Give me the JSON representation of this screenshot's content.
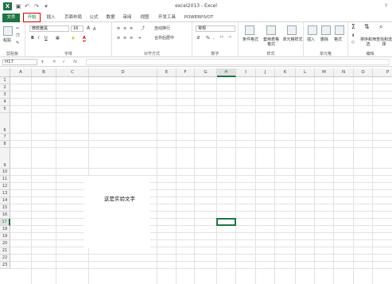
{
  "window": {
    "title": "excel2013 - Excel",
    "logo": "X",
    "help": "?",
    "qat_icons": [
      "save-icon",
      "undo-icon",
      "redo-icon",
      "customize-icon"
    ]
  },
  "tabs": [
    "文件",
    "开始",
    "插入",
    "页面布局",
    "公式",
    "数据",
    "审阅",
    "视图",
    "开发工具",
    "POWERPIVOT"
  ],
  "ribbon": {
    "clipboard": {
      "paste": "粘贴",
      "label": "剪贴板"
    },
    "font": {
      "name": "微软雅黑",
      "size": "16",
      "grow": "A",
      "shrink": "A",
      "bold": "B",
      "italic": "I",
      "underline": "U",
      "font_color": "A",
      "label": "字体"
    },
    "alignment": {
      "wrap": "自动换行",
      "merge": "合并后居中",
      "label": "对齐方式"
    },
    "number": {
      "format": "常规",
      "percent": "%",
      "comma": ",",
      "label": "数字"
    },
    "styles": {
      "conditional": "条件格式",
      "table": "套用表格格式",
      "cell_styles": "单元格样式",
      "label": "样式"
    },
    "cells": {
      "insert": "插入",
      "delete": "删除",
      "format": "格式",
      "label": "单元格"
    },
    "editing": {
      "sum": "Σ",
      "sort": "排序和筛选",
      "find": "查找和选择",
      "label": "编辑"
    }
  },
  "formula_bar": {
    "name_box": "H17",
    "cancel": "✕",
    "enter": "✓",
    "fx": "fx",
    "value": ""
  },
  "sheet": {
    "columns": [
      "A",
      "B",
      "C",
      "D",
      "E",
      "F",
      "G",
      "H",
      "I",
      "J",
      "K",
      "L",
      "M",
      "N",
      "O",
      "P"
    ],
    "rows": [
      "1",
      "2",
      "3",
      "4",
      "5",
      "6",
      "7",
      "8",
      "9",
      "10",
      "11",
      "12",
      "13",
      "14",
      "15",
      "16",
      "17",
      "18",
      "19",
      "20",
      "21",
      "22",
      "23"
    ],
    "selected_column": "H",
    "selected_row": "17",
    "merged_text": "这是实验文字"
  }
}
